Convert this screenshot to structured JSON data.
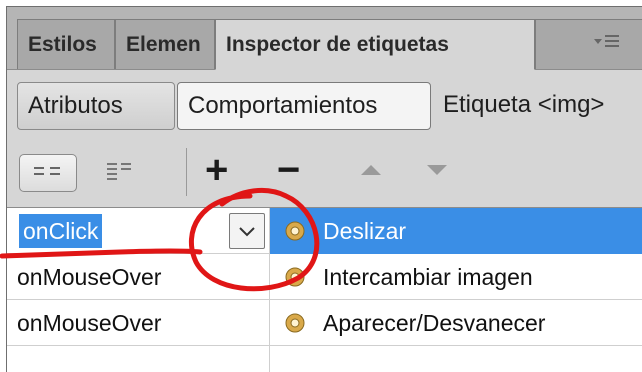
{
  "tabs": [
    {
      "label": "Estilos"
    },
    {
      "label": "Elemen"
    },
    {
      "label": "Inspector de etiquetas"
    }
  ],
  "subtabs": [
    {
      "label": "Atributos"
    },
    {
      "label": "Comportamientos"
    },
    {
      "label": "Etiqueta <img>"
    }
  ],
  "toolbar": {
    "add_label": "+",
    "remove_label": "−",
    "up_icon": "triangle-up-icon",
    "down_icon": "triangle-down-icon"
  },
  "rows": [
    {
      "event": "onClick",
      "action": "Deslizar"
    },
    {
      "event": "onMouseOver",
      "action": "Intercambiar imagen"
    },
    {
      "event": "onMouseOver",
      "action": "Aparecer/Desvanecer"
    }
  ],
  "colors": {
    "selection": "#3a8ee6",
    "annotation": "#e01616"
  }
}
